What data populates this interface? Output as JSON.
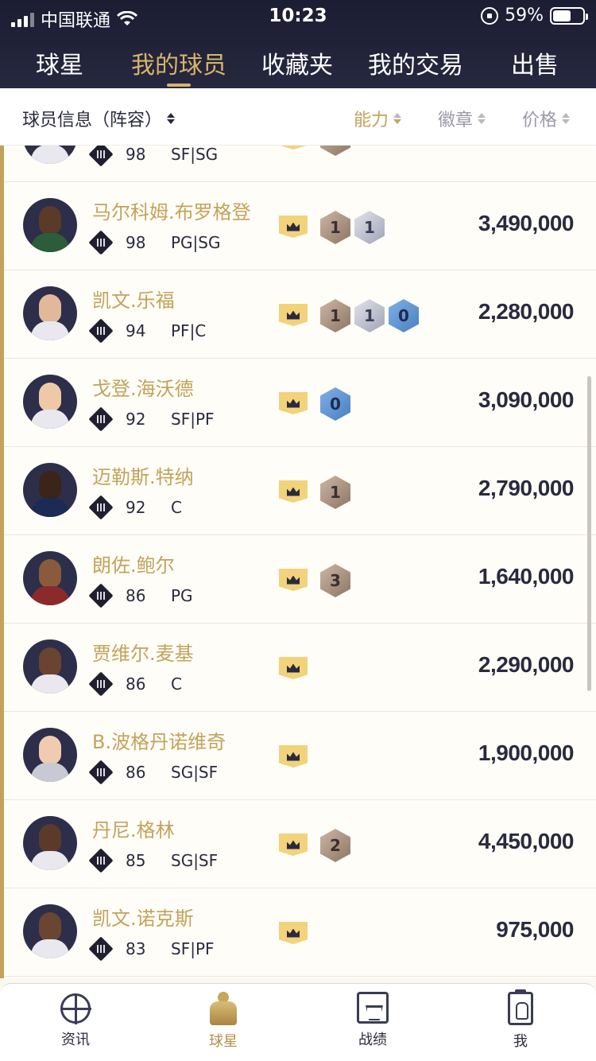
{
  "status_bar": {
    "carrier": "中国联通",
    "time": "10:23",
    "battery": "59%"
  },
  "tabs": [
    {
      "label": "球星",
      "active": false
    },
    {
      "label": "我的球员",
      "active": true
    },
    {
      "label": "收藏夹",
      "active": false
    },
    {
      "label": "我的交易",
      "active": false
    },
    {
      "label": "出售",
      "active": false
    }
  ],
  "sort_bar": {
    "player_info": "球员信息（阵容）",
    "ability": "能力",
    "badges": "徽章",
    "price": "价格"
  },
  "partial_row": {
    "ovr": "98",
    "position": "SF|SG"
  },
  "players": [
    {
      "name": "马尔科姆.布罗格登",
      "ovr": "98",
      "position": "PG|SG",
      "badges": [
        {
          "type": "bronze",
          "count": "1"
        },
        {
          "type": "silver",
          "count": "1"
        }
      ],
      "price": "3,490,000"
    },
    {
      "name": "凯文.乐福",
      "ovr": "94",
      "position": "PF|C",
      "badges": [
        {
          "type": "bronze",
          "count": "1"
        },
        {
          "type": "silver",
          "count": "1"
        },
        {
          "type": "gold",
          "count": "0"
        }
      ],
      "price": "2,280,000"
    },
    {
      "name": "戈登.海沃德",
      "ovr": "92",
      "position": "SF|PF",
      "badges": [
        {
          "type": "gold",
          "count": "0"
        }
      ],
      "price": "3,090,000"
    },
    {
      "name": "迈勒斯.特纳",
      "ovr": "92",
      "position": "C",
      "badges": [
        {
          "type": "bronze",
          "count": "1"
        }
      ],
      "price": "2,790,000"
    },
    {
      "name": "朗佐.鲍尔",
      "ovr": "86",
      "position": "PG",
      "badges": [
        {
          "type": "bronze",
          "count": "3"
        }
      ],
      "price": "1,640,000"
    },
    {
      "name": "贾维尔.麦基",
      "ovr": "86",
      "position": "C",
      "badges": [],
      "price": "2,290,000"
    },
    {
      "name": "B.波格丹诺维奇",
      "ovr": "86",
      "position": "SG|SF",
      "badges": [],
      "price": "1,900,000"
    },
    {
      "name": "丹尼.格林",
      "ovr": "85",
      "position": "SG|SF",
      "badges": [
        {
          "type": "bronze",
          "count": "2"
        }
      ],
      "price": "4,450,000"
    },
    {
      "name": "凯文.诺克斯",
      "ovr": "83",
      "position": "SF|PF",
      "badges": [],
      "price": "975,000"
    }
  ],
  "bottom_nav": [
    {
      "label": "资讯",
      "icon": "basketball-icon",
      "active": false
    },
    {
      "label": "球星",
      "icon": "player-icon",
      "active": true
    },
    {
      "label": "战绩",
      "icon": "hoop-icon",
      "active": false
    },
    {
      "label": "我",
      "icon": "profile-clipboard-icon",
      "active": false
    }
  ]
}
